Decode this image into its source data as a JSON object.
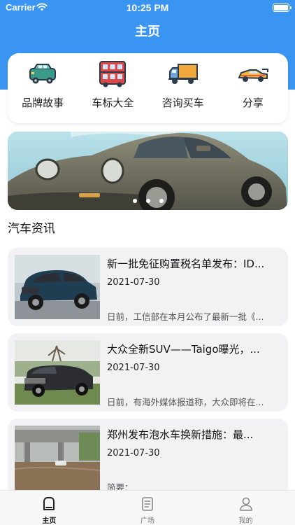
{
  "status_bar": {
    "carrier": "Carrier",
    "time": "10:25 PM"
  },
  "page_title": "主页",
  "quick_menu": [
    {
      "label": "品牌故事",
      "icon": "car-icon"
    },
    {
      "label": "车标大全",
      "icon": "bus-icon"
    },
    {
      "label": "咨询买车",
      "icon": "truck-icon"
    },
    {
      "label": "分享",
      "icon": "sports-car-icon"
    }
  ],
  "banner": {
    "pages": 3,
    "active_page": 1
  },
  "section_title": "汽车资讯",
  "news": [
    {
      "title": "新一批免征购置税名单发布：ID...",
      "date": "2021-07-30",
      "summary": "日前，工信部在本月公布了最新一批《..."
    },
    {
      "title": "大众全新SUV——Taigo曝光，...",
      "date": "2021-07-30",
      "summary": "日前，有海外媒体报道称，大众即将在..."
    },
    {
      "title": "郑州发布泡水车换新措施：最...",
      "date": "2021-07-30",
      "summary": "简要："
    }
  ],
  "tabs": [
    {
      "label": "主页",
      "icon": "home-icon",
      "active": true
    },
    {
      "label": "广场",
      "icon": "document-icon",
      "active": false
    },
    {
      "label": "我的",
      "icon": "user-icon",
      "active": false
    }
  ],
  "colors": {
    "header": "#3a95f2",
    "card": "#f2f2f4",
    "tab_bar": "#f7f7f7"
  }
}
